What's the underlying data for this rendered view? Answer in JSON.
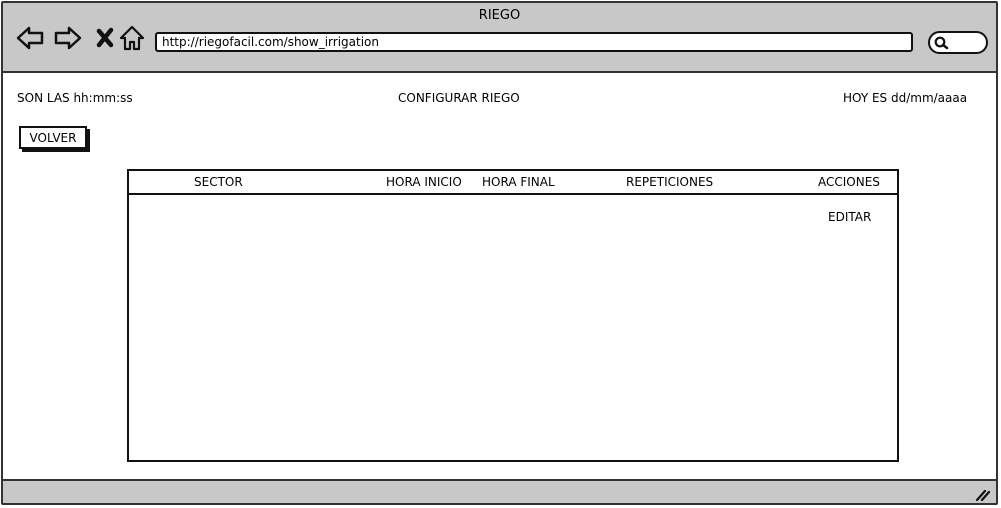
{
  "window": {
    "title": "RIEGO"
  },
  "browser": {
    "url": "http://riegofacil.com/show_irrigation",
    "icons": [
      "back-arrow-icon",
      "forward-arrow-icon",
      "close-x-icon",
      "home-icon",
      "search-icon",
      "resize-grip-icon"
    ]
  },
  "header": {
    "time_label": "SON LAS hh:mm:ss",
    "page_title": "CONFIGURAR RIEGO",
    "date_label": "HOY ES dd/mm/aaaa"
  },
  "toolbar": {
    "back_label": "VOLVER"
  },
  "table": {
    "columns": [
      "SECTOR",
      "HORA INICIO",
      "HORA FINAL",
      "REPETICIONES",
      "ACCIONES"
    ],
    "rows": [
      {
        "action": "EDITAR"
      }
    ]
  }
}
